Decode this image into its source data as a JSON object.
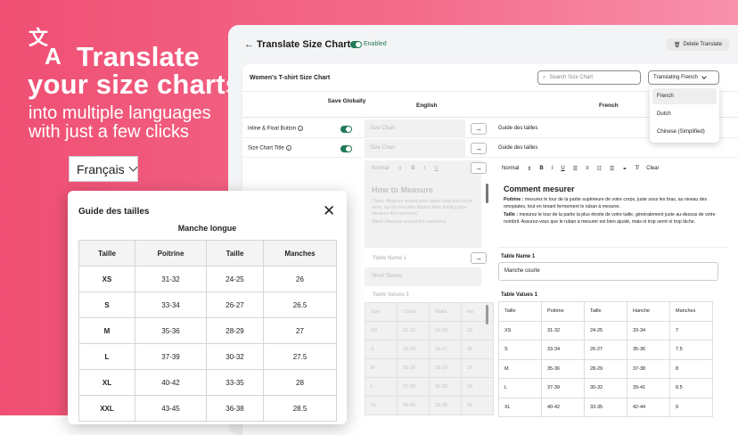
{
  "hero": {
    "headline1": "Translate",
    "headline2": "your size charts",
    "sub1": "into multiple languages",
    "sub2": "with just a few clicks"
  },
  "lang_selector": {
    "value": "Français"
  },
  "modal": {
    "title": "Guide des tailles",
    "subtitle": "Manche longue",
    "headers": [
      "Taille",
      "Poitrine",
      "Taille",
      "Manches"
    ],
    "rows": [
      [
        "XS",
        "31-32",
        "24-25",
        "26"
      ],
      [
        "S",
        "33-34",
        "26-27",
        "26.5"
      ],
      [
        "M",
        "35-36",
        "28-29",
        "27"
      ],
      [
        "L",
        "37-39",
        "30-32",
        "27.5"
      ],
      [
        "XL",
        "40-42",
        "33-35",
        "28"
      ],
      [
        "XXL",
        "43-45",
        "36-38",
        "28.5"
      ]
    ]
  },
  "app": {
    "title": "Translate Size Chart",
    "status": "Enabled",
    "delete_label": "Delete Translate",
    "card_title": "Women's T-shirt Size Chart",
    "search_placeholder": "Search Size Chart",
    "translating": "Translating French",
    "col_save": "Save Globally",
    "col_english": "English",
    "col_french": "French",
    "rows": [
      {
        "label": "Inline & Float Button",
        "en": "Size Chart",
        "fr": "Guide des tailles"
      },
      {
        "label": "Size Chart Title",
        "en": "Size Chart",
        "fr": "Guide des tailles"
      }
    ],
    "en_toolbar": "Normal",
    "fr_toolbar": "Normal",
    "clear": "Clear",
    "en_heading": "How to Measure",
    "en_p1": "Chest: Measure around your upper body just below arms, across shoulder blades while holding tape measure firm and level.",
    "en_p2": "Waist: Measure around the narrowest",
    "fr_heading": "Comment mesurer",
    "fr_p1_bold": "Poitrine :",
    "fr_p1": " mesurez le tour de la partie supérieure de votre corps, juste sous les bras, au niveau des omoplates, tout en tenant fermement le ruban à mesurer.",
    "fr_p2_bold": "Taille :",
    "fr_p2": " mesurez le tour de la partie la plus étroite de votre taille, généralement juste au-dessus de votre nombril. Assurez-vous que le ruban à mesurer est bien ajusté, mais ni trop serré ni trop lâche.",
    "table_name_label": "Table Name 1",
    "en_table_name": "Short Sleeve",
    "fr_table_name": "Manche courte",
    "table_values_label": "Table Values 1",
    "en_table": [
      [
        "Size",
        "Chest",
        "Waist",
        "Ha"
      ],
      [
        "XS",
        "31-32",
        "24-25",
        "33"
      ],
      [
        "S",
        "33-34",
        "26-27",
        "35"
      ],
      [
        "M",
        "35-36",
        "28-29",
        "37"
      ],
      [
        "L",
        "37-39",
        "30-32",
        "39"
      ],
      [
        "XL",
        "40-42",
        "33-35",
        "42"
      ]
    ],
    "fr_table": [
      [
        "Taille",
        "Poitrine",
        "Taille",
        "Hanche",
        "Manches"
      ],
      [
        "XS",
        "31-32",
        "24-25",
        "33-34",
        "7"
      ],
      [
        "S",
        "33-34",
        "26-27",
        "35-36",
        "7.5"
      ],
      [
        "M",
        "35-36",
        "28-29",
        "37-38",
        "8"
      ],
      [
        "L",
        "37-39",
        "30-32",
        "39-41",
        "8.5"
      ],
      [
        "XL",
        "40-42",
        "33-35",
        "42-44",
        "9"
      ]
    ]
  },
  "dropdown": {
    "options": [
      "French",
      "Dutch",
      "Chinese (Simplified)"
    ],
    "selected": "French"
  },
  "colors": {
    "accent": "#ef4f73",
    "green": "#1f7a55"
  }
}
